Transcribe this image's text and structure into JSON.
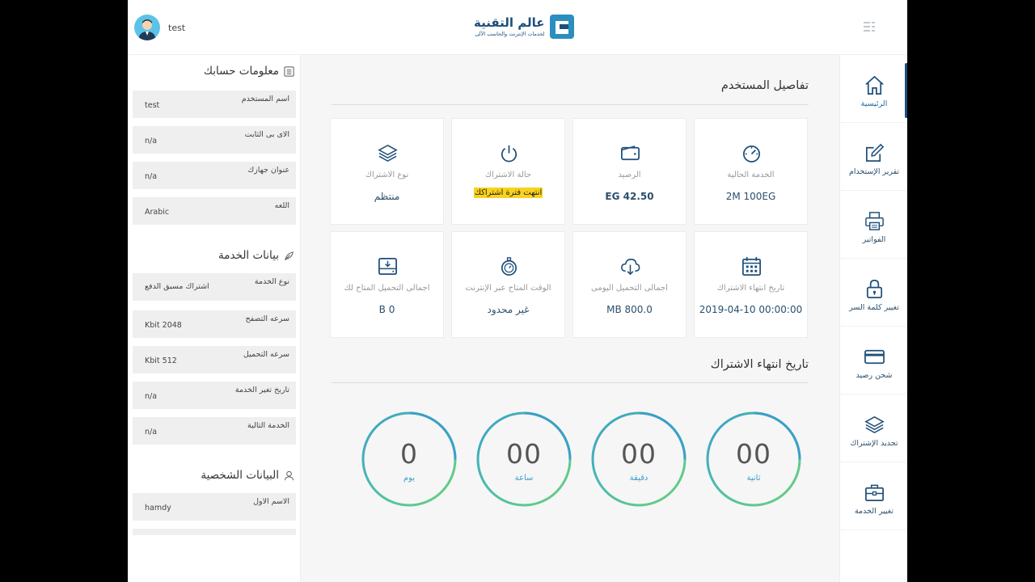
{
  "header": {
    "username": "test",
    "logo_main": "عالم التقنية",
    "logo_sub": "لخدمات الإنترنت والحاسب الآلى"
  },
  "account_info": {
    "title": "معلومات حسابك",
    "rows": [
      {
        "label": "اسم المستخدم",
        "value": "test"
      },
      {
        "label": "الاى بى الثابت",
        "value": "n/a"
      },
      {
        "label": "عنوان جهازك",
        "value": "n/a"
      },
      {
        "label": "اللغه",
        "value": "Arabic"
      }
    ]
  },
  "service_info": {
    "title": "بيانات الخدمة",
    "rows": [
      {
        "label": "نوع الخدمة",
        "value": "اشتراك مسبق الدفع"
      },
      {
        "label": "سرعه التصفح",
        "value": "Kbit 2048"
      },
      {
        "label": "سرعه التحميل",
        "value": "Kbit 512"
      },
      {
        "label": "تاريخ تغير الخدمة",
        "value": "n/a"
      },
      {
        "label": "الخدمة التالية",
        "value": "n/a"
      }
    ]
  },
  "personal_info": {
    "title": "البيانات الشخصية",
    "rows": [
      {
        "label": "الاسم الاول",
        "value": "hamdy"
      }
    ]
  },
  "user_details": {
    "title": "تفاصيل المستخدم",
    "cards": [
      {
        "icon": "gauge-icon",
        "label": "الخدمة الحالية",
        "value": "2M 100EG"
      },
      {
        "icon": "wallet-icon",
        "label": "الرصيد",
        "value": "EG 42.50"
      },
      {
        "icon": "power-icon",
        "label": "حالة الاشتراك",
        "value": "انتهت فترة اشتراكك"
      },
      {
        "icon": "layers-icon",
        "label": "نوع الاشتراك",
        "value": "منتظم"
      },
      {
        "icon": "calendar-icon",
        "label": "تاريخ انتهاء الاشتراك",
        "value": "2019-04-10 00:00:00"
      },
      {
        "icon": "cloud-download-icon",
        "label": "اجمالى التحميل اليومى",
        "value": "MB 800.0"
      },
      {
        "icon": "stopwatch-icon",
        "label": "الوقت المتاح عبر الإنترنت",
        "value": "غير محدود"
      },
      {
        "icon": "drive-download-icon",
        "label": "اجمالى التحميل المتاح لك",
        "value": "B 0"
      }
    ]
  },
  "expiry": {
    "title": "تاريخ انتهاء الاشتراك",
    "counters": [
      {
        "value": "00",
        "unit": "ثانية"
      },
      {
        "value": "00",
        "unit": "دقيقة"
      },
      {
        "value": "00",
        "unit": "ساعة"
      },
      {
        "value": "0",
        "unit": "يوم"
      }
    ]
  },
  "nav": {
    "items": [
      {
        "icon": "home-icon",
        "label": "الرئيسية"
      },
      {
        "icon": "edit-icon",
        "label": "تقرير الإستخدام"
      },
      {
        "icon": "printer-icon",
        "label": "الفواتير"
      },
      {
        "icon": "lock-icon",
        "label": "تغيير كلمة السر"
      },
      {
        "icon": "credit-card-icon",
        "label": "شحن رصيد"
      },
      {
        "icon": "layers-icon",
        "label": "تجديد الإشتراك"
      },
      {
        "icon": "briefcase-icon",
        "label": "تغيير الخدمة"
      }
    ]
  },
  "colors": {
    "accent": "#1e4f7a",
    "highlight": "#f9d21d",
    "ring_green": "#6cd07a",
    "ring_blue": "#3aa0c8"
  }
}
